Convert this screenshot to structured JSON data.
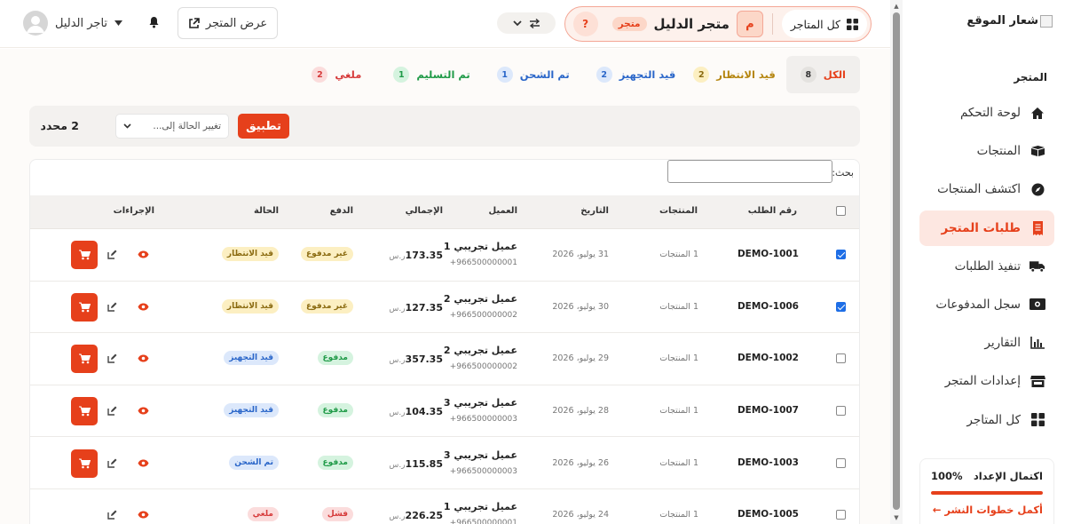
{
  "colors": {
    "accent": "#e6401b",
    "accent_soft": "#fde7e1"
  },
  "sidebar": {
    "logo_text": "شعار الموقع",
    "section_title": "المتجر",
    "items": [
      {
        "label": "لوحة التحكم",
        "icon": "home-icon",
        "active": false
      },
      {
        "label": "المنتجات",
        "icon": "box-icon",
        "active": false
      },
      {
        "label": "اكتشف المنتجات",
        "icon": "compass-icon",
        "active": false
      },
      {
        "label": "طلبات المتجر",
        "icon": "receipt-icon",
        "active": true
      },
      {
        "label": "تنفيذ الطلبات",
        "icon": "truck-icon",
        "active": false
      },
      {
        "label": "سجل المدفوعات",
        "icon": "money-icon",
        "active": false
      },
      {
        "label": "التقارير",
        "icon": "chart-icon",
        "active": false
      },
      {
        "label": "إعدادات المتجر",
        "icon": "store-icon",
        "active": false
      },
      {
        "label": "كل المتاجر",
        "icon": "grid-icon",
        "active": false
      }
    ],
    "setup": {
      "title": "اكتمال الإعداد",
      "percent_label": "100%",
      "percent": 100,
      "link": "أكمل خطوات النشر ←"
    }
  },
  "topbar": {
    "all_stores": "كل المتاجر",
    "store_avatar": "م",
    "store_name": "متجر الدليل",
    "store_badge": "متجر",
    "help": "?",
    "view_store": "عرض المتجر",
    "user_name": "تاجر الدليل"
  },
  "tabs": [
    {
      "label": "الكل",
      "count": "8",
      "color": "#e6401b",
      "badge_bg": "#e4e2df",
      "badge_fg": "#333333",
      "active": true
    },
    {
      "label": "قيد الانتظار",
      "count": "2",
      "color": "#b5850f",
      "badge_bg": "#fcefc2",
      "badge_fg": "#8a6a10",
      "active": false
    },
    {
      "label": "قيد التجهيز",
      "count": "2",
      "color": "#2a66c9",
      "badge_bg": "#dce8fb",
      "badge_fg": "#2a66c9",
      "active": false
    },
    {
      "label": "تم الشحن",
      "count": "1",
      "color": "#2a66c9",
      "badge_bg": "#dce8fb",
      "badge_fg": "#2a66c9",
      "active": false
    },
    {
      "label": "تم التسليم",
      "count": "1",
      "color": "#1f9a47",
      "badge_bg": "#d5f3df",
      "badge_fg": "#1f9a47",
      "active": false
    },
    {
      "label": "ملغي",
      "count": "2",
      "color": "#d63b3b",
      "badge_bg": "#fbdcdc",
      "badge_fg": "#d63b3b",
      "active": false
    }
  ],
  "bulk": {
    "selected_count": "2 محدد",
    "status_placeholder": "تغيير الحالة إلى...",
    "apply": "تطبيق"
  },
  "table": {
    "search_label": "بحث:",
    "headers": {
      "order": "رقم الطلب",
      "products": "المنتجات",
      "date": "التاريخ",
      "customer": "العميل",
      "total": "الإجمالي",
      "payment": "الدفع",
      "status": "الحالة",
      "actions": "الإجراءات"
    },
    "currency": "ر.س",
    "rows": [
      {
        "checked": true,
        "id": "DEMO-1001",
        "products": "1 المنتجات",
        "date": "31 يوليو، 2026",
        "customer": "عميل تجريبي 1",
        "phone": "+966500000001",
        "total": "173.35",
        "payment": "غير مدفوع",
        "pay_bg": "#fcefc2",
        "pay_fg": "#8a6a10",
        "status": "قيد الانتظار",
        "st_bg": "#fcefc2",
        "st_fg": "#8a6a10",
        "cart": true
      },
      {
        "checked": true,
        "id": "DEMO-1006",
        "products": "1 المنتجات",
        "date": "30 يوليو، 2026",
        "customer": "عميل تجريبي 2",
        "phone": "+966500000002",
        "total": "127.35",
        "payment": "غير مدفوع",
        "pay_bg": "#fcefc2",
        "pay_fg": "#8a6a10",
        "status": "قيد الانتظار",
        "st_bg": "#fcefc2",
        "st_fg": "#8a6a10",
        "cart": true
      },
      {
        "checked": false,
        "id": "DEMO-1002",
        "products": "1 المنتجات",
        "date": "29 يوليو، 2026",
        "customer": "عميل تجريبي 2",
        "phone": "+966500000002",
        "total": "357.35",
        "payment": "مدفوع",
        "pay_bg": "#d5f3df",
        "pay_fg": "#1f9a47",
        "status": "قيد التجهيز",
        "st_bg": "#dce8fb",
        "st_fg": "#2a66c9",
        "cart": true
      },
      {
        "checked": false,
        "id": "DEMO-1007",
        "products": "1 المنتجات",
        "date": "28 يوليو، 2026",
        "customer": "عميل تجريبي 3",
        "phone": "+966500000003",
        "total": "104.35",
        "payment": "مدفوع",
        "pay_bg": "#d5f3df",
        "pay_fg": "#1f9a47",
        "status": "قيد التجهيز",
        "st_bg": "#dce8fb",
        "st_fg": "#2a66c9",
        "cart": true
      },
      {
        "checked": false,
        "id": "DEMO-1003",
        "products": "1 المنتجات",
        "date": "26 يوليو، 2026",
        "customer": "عميل تجريبي 3",
        "phone": "+966500000003",
        "total": "115.85",
        "payment": "مدفوع",
        "pay_bg": "#d5f3df",
        "pay_fg": "#1f9a47",
        "status": "تم الشحن",
        "st_bg": "#dce8fb",
        "st_fg": "#2a66c9",
        "cart": true
      },
      {
        "checked": false,
        "id": "DEMO-1005",
        "products": "1 المنتجات",
        "date": "24 يوليو، 2026",
        "customer": "عميل تجريبي 1",
        "phone": "+966500000001",
        "total": "226.25",
        "payment": "فشل",
        "pay_bg": "#fbdcdc",
        "pay_fg": "#d63b3b",
        "status": "ملغي",
        "st_bg": "#fbdcdc",
        "st_fg": "#d63b3b",
        "cart": false
      }
    ]
  }
}
